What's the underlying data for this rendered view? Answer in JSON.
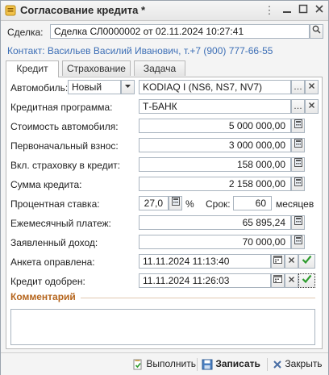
{
  "window": {
    "title": "Согласование кредита *"
  },
  "deal": {
    "label": "Сделка:",
    "value": "Сделка СЛ0000002 от 02.11.2024 10:27:41"
  },
  "contact": {
    "text": "Контакт: Васильев Василий Иванович, т.+7 (900) 777-66-55"
  },
  "tabs": [
    {
      "label": "Кредит",
      "active": true
    },
    {
      "label": "Страхование",
      "active": false
    },
    {
      "label": "Задача",
      "active": false
    }
  ],
  "form": {
    "car_label": "Автомобиль:",
    "car_condition": "Новый",
    "car_model": "KODIAQ I (NS6, NS7, NV7)",
    "program_label": "Кредитная программа:",
    "program_value": "Т-БАНК",
    "price_label": "Стоимость автомобиля:",
    "price_value": "5 000 000,00",
    "down_label": "Первоначальный взнос:",
    "down_value": "3 000 000,00",
    "insurance_label": "Вкл. страховку в кредит:",
    "insurance_value": "158 000,00",
    "loan_label": "Сумма кредита:",
    "loan_value": "2 158 000,00",
    "rate_label": "Процентная ставка:",
    "rate_value": "27,0",
    "rate_unit": "%",
    "term_label": "Срок:",
    "term_value": "60",
    "term_unit": "месяцев",
    "monthly_label": "Ежемесячный платеж:",
    "monthly_value": "65 895,24",
    "income_label": "Заявленный доход:",
    "income_value": "70 000,00",
    "sent_label": "Анкета оправлена:",
    "sent_value": "11.11.2024 11:13:40",
    "approved_label": "Кредит одобрен:",
    "approved_value": "11.11.2024 11:26:03",
    "comment_title": "Комментарий",
    "comment_value": ""
  },
  "footer": {
    "execute_label": "Выполнить",
    "save_label": "Записать",
    "close_label": "Закрыть"
  },
  "colors": {
    "link": "#3d6fb6",
    "section": "#b5651d",
    "check": "#2e9b2e",
    "close_x": "#c0392b"
  }
}
